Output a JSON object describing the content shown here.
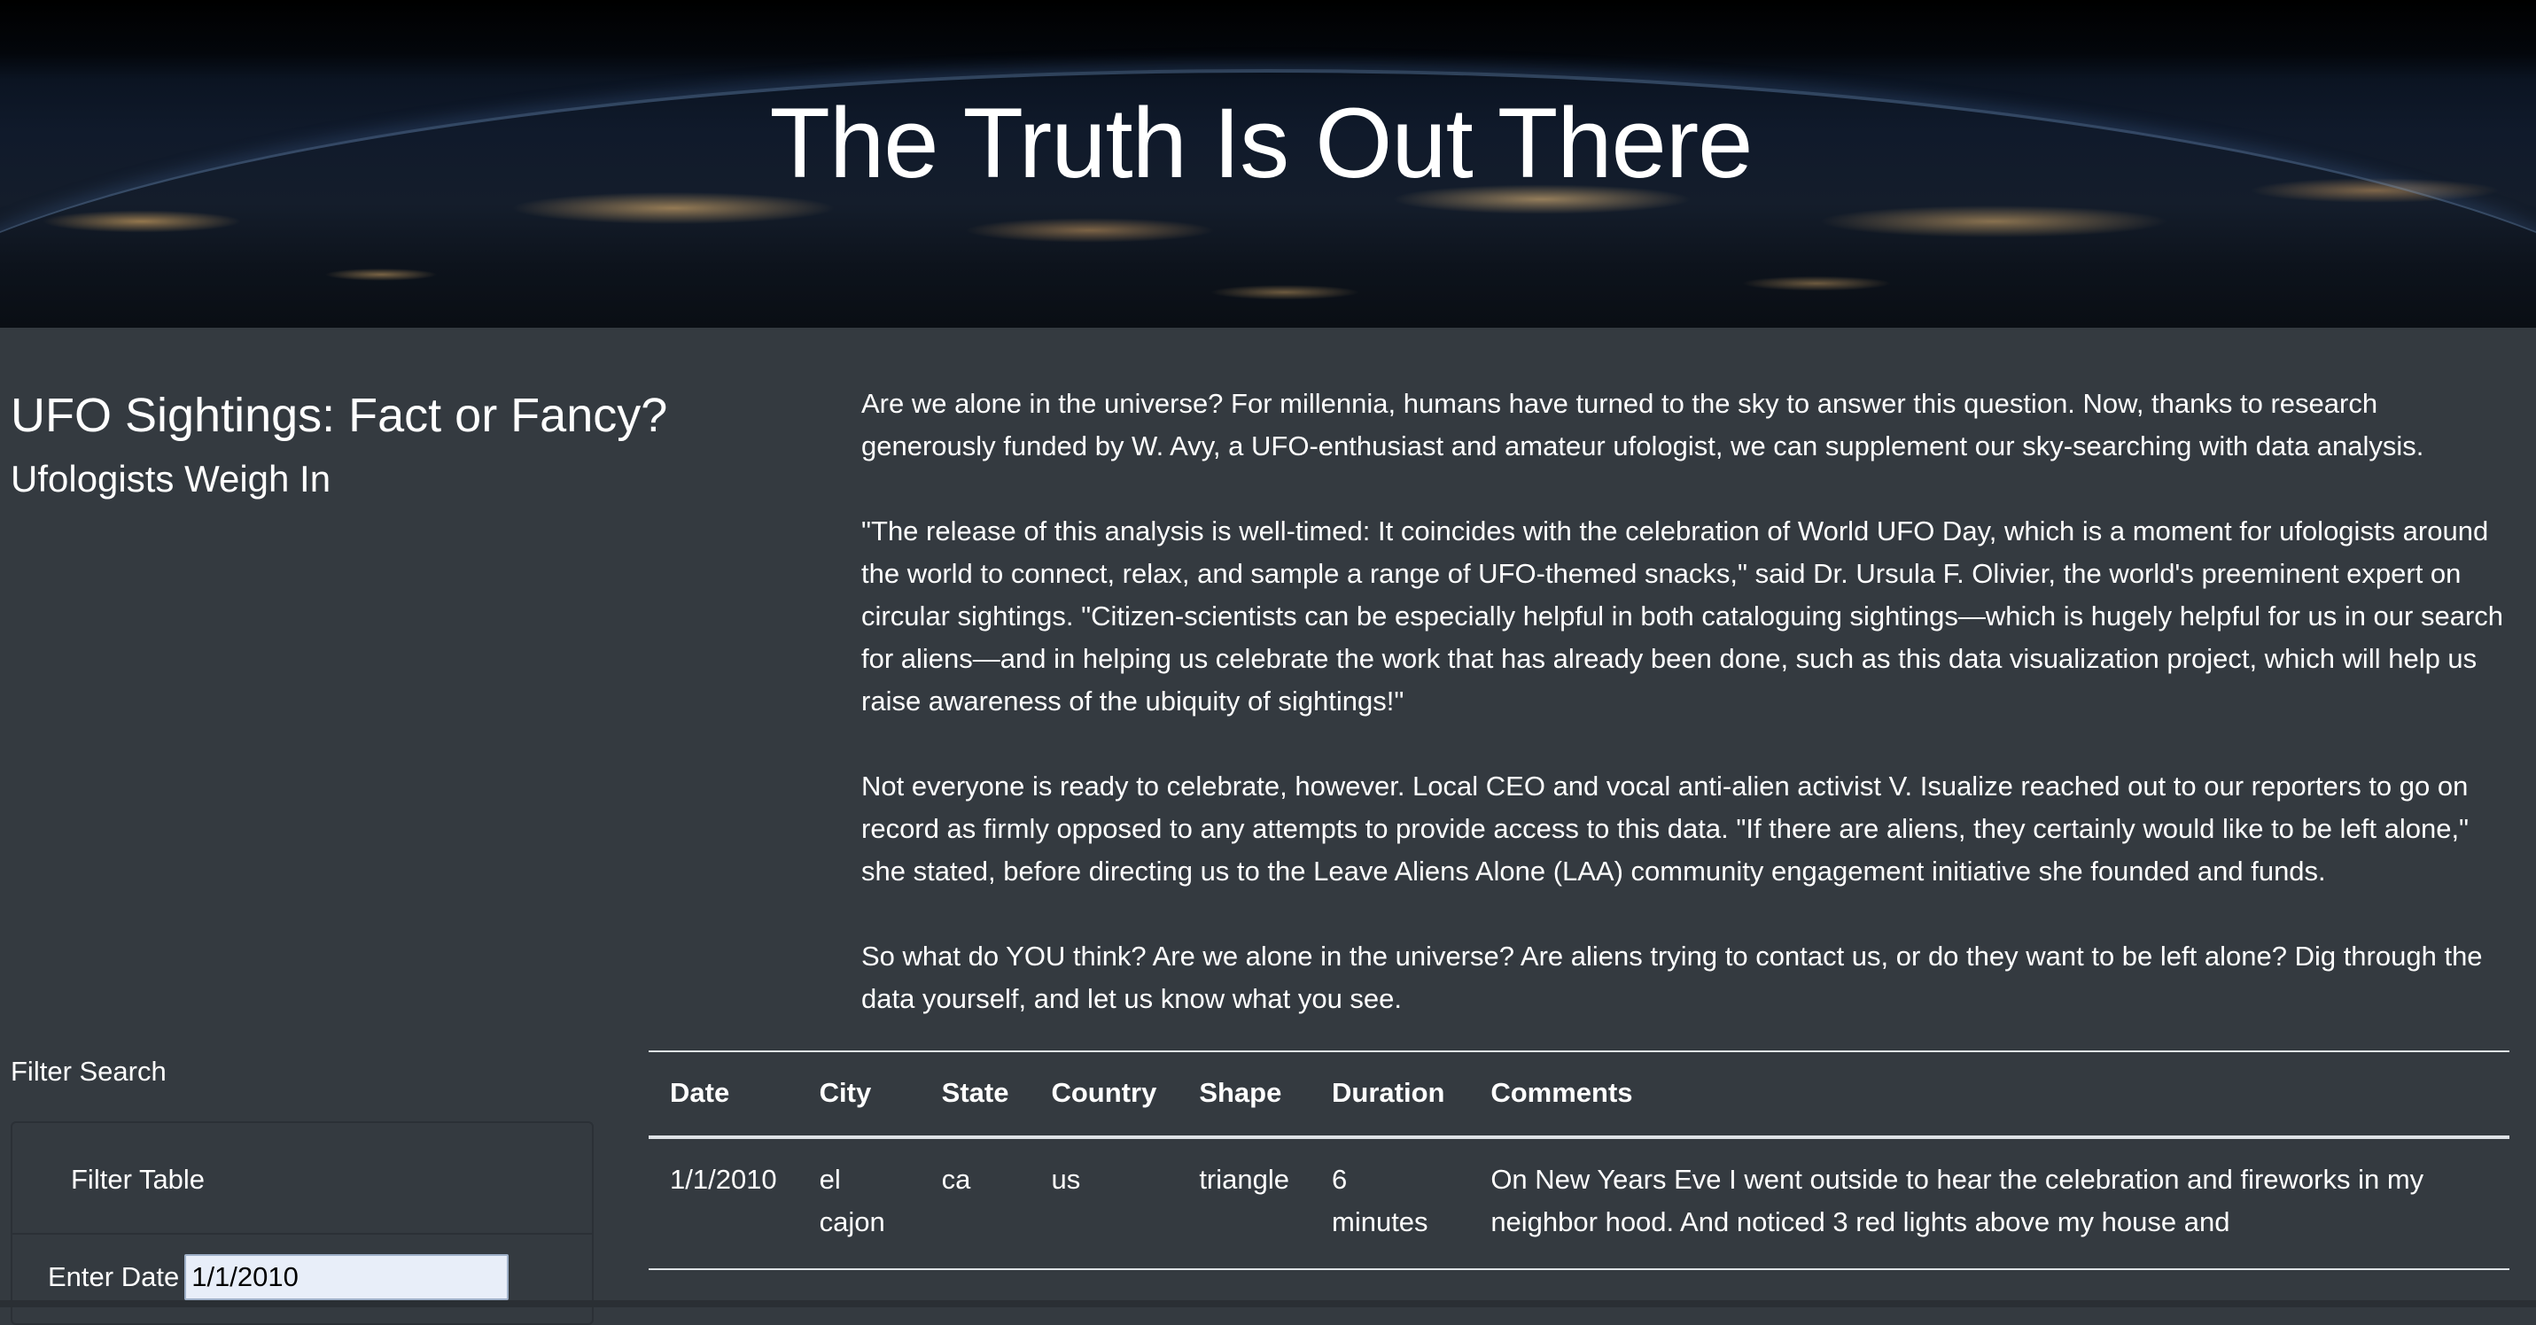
{
  "hero": {
    "title": "The Truth Is Out There"
  },
  "article": {
    "title": "UFO Sightings: Fact or Fancy?",
    "subtitle": "Ufologists Weigh In",
    "paragraphs": [
      "Are we alone in the universe? For millennia, humans have turned to the sky to answer this question. Now, thanks to research generously funded by W. Avy, a UFO-enthusiast and amateur ufologist, we can supplement our sky-searching with data analysis.",
      "\"The release of this analysis is well-timed: It coincides with the celebration of World UFO Day, which is a moment for ufologists around the world to connect, relax, and sample a range of UFO-themed snacks,\" said Dr. Ursula F. Olivier, the world's preeminent expert on circular sightings. \"Citizen-scientists can be especially helpful in both cataloguing sightings—which is hugely helpful for us in our search for aliens—and in helping us celebrate the work that has already been done, such as this data visualization project, which will help us raise awareness of the ubiquity of sightings!\"",
      "Not everyone is ready to celebrate, however. Local CEO and vocal anti-alien activist V. Isualize reached out to our reporters to go on record as firmly opposed to any attempts to provide access to this data. \"If there are aliens, they certainly would like to be left alone,\" she stated, before directing us to the Leave Aliens Alone (LAA) community engagement initiative she founded and funds.",
      "So what do YOU think? Are we alone in the universe? Are aliens trying to contact us, or do they want to be left alone? Dig through the data yourself, and let us know what you see."
    ]
  },
  "filter": {
    "section_label": "Filter Search",
    "card_title": "Filter Table",
    "date_label": "Enter Date",
    "date_value": "1/1/2010"
  },
  "table": {
    "headers": [
      "Date",
      "City",
      "State",
      "Country",
      "Shape",
      "Duration",
      "Comments"
    ],
    "rows": [
      {
        "date": "1/1/2010",
        "city": "el cajon",
        "state": "ca",
        "country": "us",
        "shape": "triangle",
        "duration": "6 minutes",
        "comments": "On New Years Eve I went outside to hear the celebration and fireworks in my neighbor hood. And noticed 3 red lights above my house and"
      }
    ]
  }
}
